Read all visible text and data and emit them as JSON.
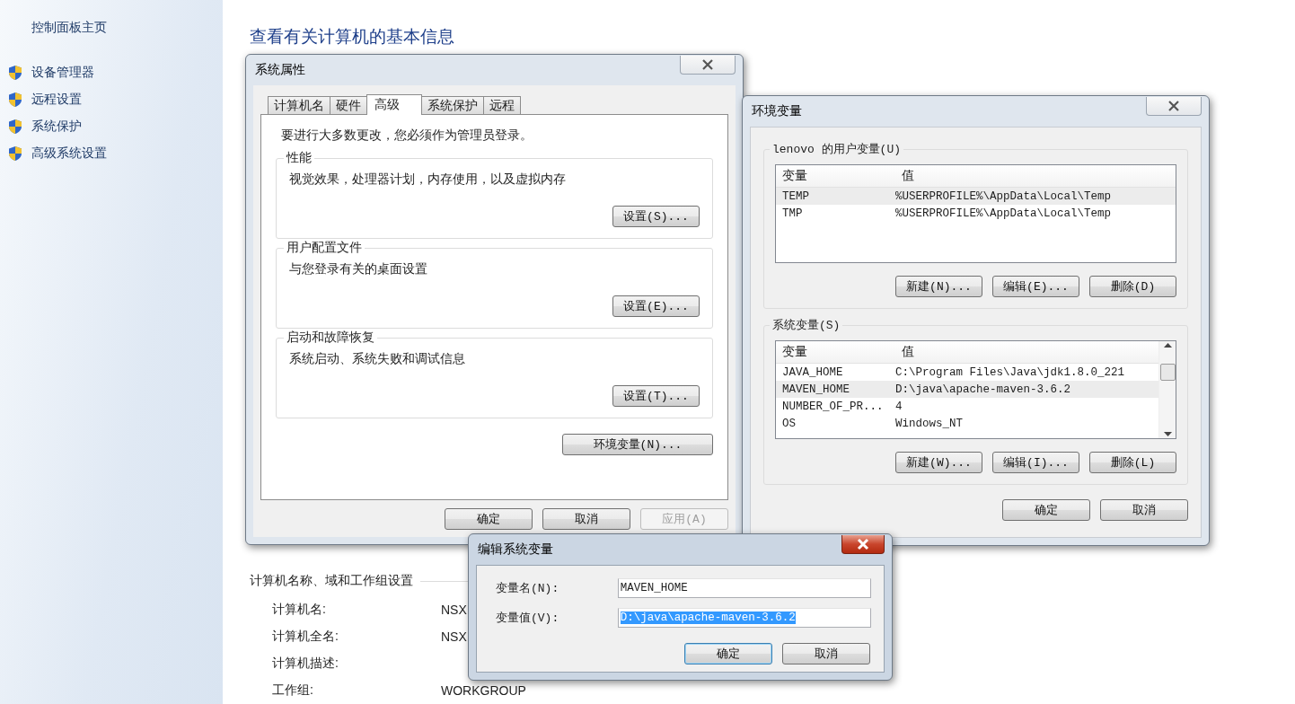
{
  "sidebar": {
    "home": "控制面板主页",
    "items": [
      {
        "label": "设备管理器"
      },
      {
        "label": "远程设置"
      },
      {
        "label": "系统保护"
      },
      {
        "label": "高级系统设置"
      }
    ]
  },
  "main": {
    "heading": "查看有关计算机的基本信息",
    "section": "计算机名称、域和工作组设置",
    "rows": [
      {
        "label": "计算机名:",
        "value": "NSX"
      },
      {
        "label": "计算机全名:",
        "value": "NSX"
      },
      {
        "label": "计算机描述:"
      },
      {
        "label": "工作组:",
        "value": "WORKGROUP"
      }
    ]
  },
  "system_properties": {
    "title": "系统属性",
    "tabs": [
      {
        "label": "计算机名",
        "selected": false
      },
      {
        "label": "硬件",
        "selected": false
      },
      {
        "label": "高级",
        "selected": true
      },
      {
        "label": "系统保护",
        "selected": false
      },
      {
        "label": "远程",
        "selected": false
      }
    ],
    "notice": "要进行大多数更改，您必须作为管理员登录。",
    "groups": [
      {
        "title": "性能",
        "description": "视觉效果，处理器计划，内存使用，以及虚拟内存",
        "button": "设置(S)..."
      },
      {
        "title": "用户配置文件",
        "description": "与您登录有关的桌面设置",
        "button": "设置(E)..."
      },
      {
        "title": "启动和故障恢复",
        "description": "系统启动、系统失败和调试信息",
        "button": "设置(T)..."
      }
    ],
    "env_button": "环境变量(N)...",
    "buttons": [
      {
        "label": "确定",
        "disabled": false
      },
      {
        "label": "取消",
        "disabled": false
      },
      {
        "label": "应用(A)",
        "disabled": true
      }
    ]
  },
  "environment_variables": {
    "title": "环境变量",
    "groups": [
      {
        "title": "lenovo 的用户变量(U)",
        "columns": [
          "变量",
          "值"
        ],
        "scrollbar": false,
        "rows": [
          {
            "name": "TEMP",
            "value": "%USERPROFILE%\\AppData\\Local\\Temp",
            "selected": true
          },
          {
            "name": "TMP",
            "value": "%USERPROFILE%\\AppData\\Local\\Temp",
            "selected": false
          }
        ],
        "buttons": [
          "新建(N)...",
          "编辑(E)...",
          "删除(D)"
        ]
      },
      {
        "title": "系统变量(S)",
        "columns": [
          "变量",
          "值"
        ],
        "scrollbar": true,
        "rows": [
          {
            "name": "JAVA_HOME",
            "value": "C:\\Program Files\\Java\\jdk1.8.0_221",
            "selected": false
          },
          {
            "name": "MAVEN_HOME",
            "value": "D:\\java\\apache-maven-3.6.2",
            "selected": true
          },
          {
            "name": "NUMBER_OF_PR...",
            "value": "4",
            "selected": false
          },
          {
            "name": "OS",
            "value": "Windows_NT",
            "selected": false
          }
        ],
        "buttons": [
          "新建(W)...",
          "编辑(I)...",
          "删除(L)"
        ]
      }
    ],
    "buttons": [
      "确定",
      "取消"
    ]
  },
  "edit_dialog": {
    "title": "编辑系统变量",
    "fields": [
      {
        "label": "变量名(N):",
        "value": "MAVEN_HOME",
        "selected": false
      },
      {
        "label": "变量值(V):",
        "value": "D:\\java\\apache-maven-3.6.2",
        "selected": true
      }
    ],
    "buttons": [
      {
        "label": "确定",
        "default": true
      },
      {
        "label": "取消",
        "default": false
      }
    ]
  }
}
